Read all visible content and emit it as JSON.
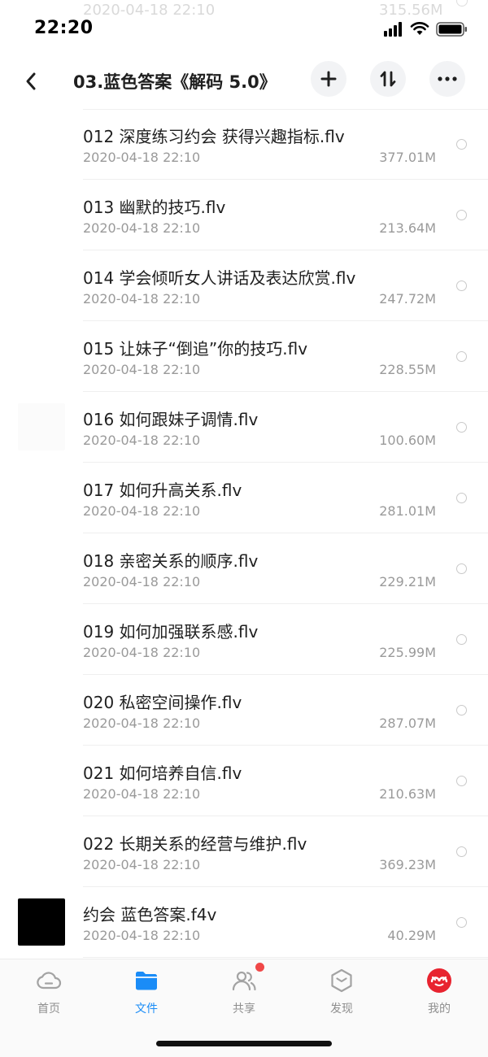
{
  "status_bar": {
    "time": "22:20"
  },
  "ghost_row": {
    "date": "2020-04-18 22:10",
    "size": "315.56M"
  },
  "nav": {
    "title": "03.蓝色答案《解码 5.0》",
    "icons": {
      "back": "chevron-left-icon",
      "add": "plus-icon",
      "sort": "sort-icon",
      "more": "more-icon"
    }
  },
  "files": [
    {
      "name": "012 深度练习约会 获得兴趣指标.flv",
      "date": "2020-04-18 22:10",
      "size": "377.01M"
    },
    {
      "name": "013 幽默的技巧.flv",
      "date": "2020-04-18 22:10",
      "size": "213.64M"
    },
    {
      "name": "014 学会倾听女人讲话及表达欣赏.flv",
      "date": "2020-04-18 22:10",
      "size": "247.72M"
    },
    {
      "name": "015 让妹子“倒追”你的技巧.flv",
      "date": "2020-04-18 22:10",
      "size": "228.55M"
    },
    {
      "name": "016 如何跟妹子调情.flv",
      "date": "2020-04-18 22:10",
      "size": "100.60M"
    },
    {
      "name": "017 如何升高关系.flv",
      "date": "2020-04-18 22:10",
      "size": "281.01M"
    },
    {
      "name": "018 亲密关系的顺序.flv",
      "date": "2020-04-18 22:10",
      "size": "229.21M"
    },
    {
      "name": "019 如何加强联系感.flv",
      "date": "2020-04-18 22:10",
      "size": "225.99M"
    },
    {
      "name": "020 私密空间操作.flv",
      "date": "2020-04-18 22:10",
      "size": "287.07M"
    },
    {
      "name": "021 如何培养自信.flv",
      "date": "2020-04-18 22:10",
      "size": "210.63M"
    },
    {
      "name": "022 长期关系的经营与维护.flv",
      "date": "2020-04-18 22:10",
      "size": "369.23M"
    },
    {
      "name": "约会 蓝色答案.f4v",
      "date": "2020-04-18 22:10",
      "size": "40.29M"
    }
  ],
  "tabs": [
    {
      "label": "首页",
      "icon": "cloud-icon"
    },
    {
      "label": "文件",
      "icon": "folder-icon",
      "active": true
    },
    {
      "label": "共享",
      "icon": "people-icon"
    },
    {
      "label": "发现",
      "icon": "discover-icon"
    },
    {
      "label": "我的",
      "icon": "profile-icon"
    }
  ],
  "colors": {
    "accent": "#1a8cf7",
    "badge": "#f04848",
    "text_secondary": "#9a9a9a"
  }
}
